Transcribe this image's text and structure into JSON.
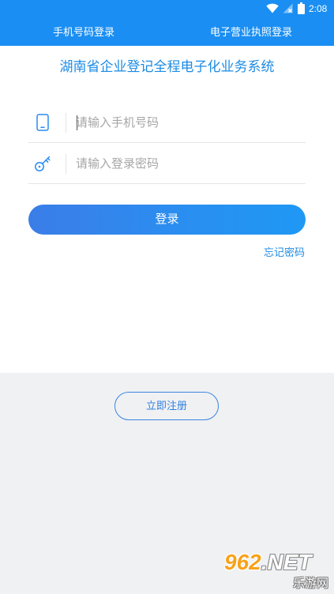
{
  "status_bar": {
    "time": "2:08",
    "icons": [
      "wifi-icon",
      "signal-off-icon",
      "battery-icon"
    ]
  },
  "tabs": [
    {
      "label": "手机号码登录"
    },
    {
      "label": "电子营业执照登录"
    }
  ],
  "title": "湖南省企业登记全程电子化业务系统",
  "form": {
    "phone": {
      "icon": "phone-icon",
      "placeholder": "请输入手机号码",
      "value": ""
    },
    "password": {
      "icon": "key-icon",
      "placeholder": "请输入登录密码",
      "value": ""
    },
    "login_label": "登录",
    "forgot_label": "忘记密码"
  },
  "register_label": "立即注册",
  "watermark": {
    "brand_number": "962",
    "brand_suffix": ".NET",
    "name": "乐游网"
  },
  "colors": {
    "primary": "#1a8ef2",
    "accent_text": "#1c8be4",
    "background": "#f0f1f3",
    "button_border": "#3a84e2"
  }
}
